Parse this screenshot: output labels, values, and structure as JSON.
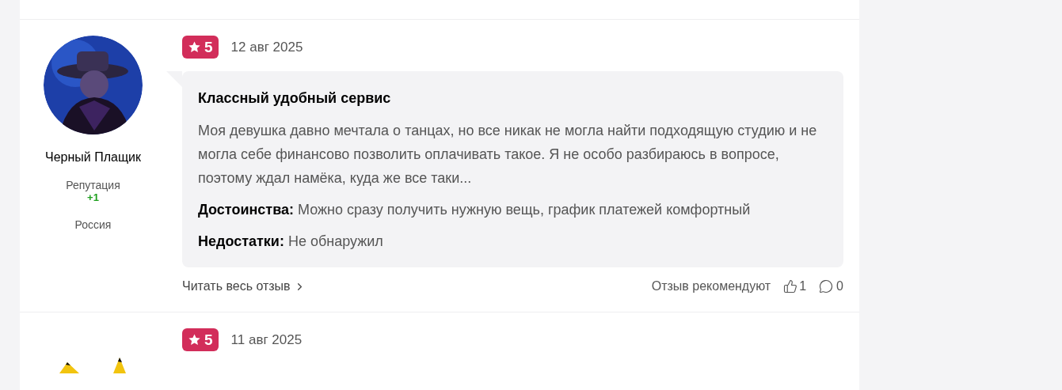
{
  "reviews": [
    {
      "author": {
        "name": "Черный Плащик",
        "reputation_label": "Репутация",
        "reputation": "+1",
        "country": "Россия"
      },
      "rating": "5",
      "date": "12 авг 2025",
      "title": "Классный удобный сервис",
      "text": "Моя девушка давно мечтала о танцах, но все никак не могла найти подходящую студию и не могла себе финансово позволить оплачивать такое. Я не особо разбираюсь в вопросе, поэтому ждал намёка, куда же все таки...",
      "pros_label": "Достоинства:",
      "pros": "Можно сразу получить нужную вещь, график платежей комфортный",
      "cons_label": "Недостатки:",
      "cons": "Не обнаружил",
      "read_more": "Читать весь отзыв",
      "recommend": "Отзыв рекомендуют",
      "likes": "1",
      "comments": "0"
    },
    {
      "rating": "5",
      "date": "11 авг 2025"
    }
  ]
}
